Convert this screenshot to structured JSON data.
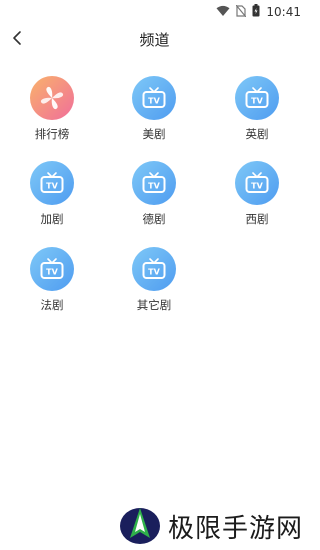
{
  "status_bar": {
    "time": "10:41"
  },
  "nav": {
    "title": "频道"
  },
  "channels": [
    {
      "label": "排行榜",
      "icon": "ranking-icon"
    },
    {
      "label": "美剧",
      "icon": "tv-icon"
    },
    {
      "label": "英剧",
      "icon": "tv-icon"
    },
    {
      "label": "加剧",
      "icon": "tv-icon"
    },
    {
      "label": "德剧",
      "icon": "tv-icon"
    },
    {
      "label": "西剧",
      "icon": "tv-icon"
    },
    {
      "label": "法剧",
      "icon": "tv-icon"
    },
    {
      "label": "其它剧",
      "icon": "tv-icon"
    }
  ],
  "watermark": {
    "text": "极限手游网"
  },
  "colors": {
    "tv_icon": "#5aa8f2",
    "ranking_icon": "#f48a86"
  }
}
